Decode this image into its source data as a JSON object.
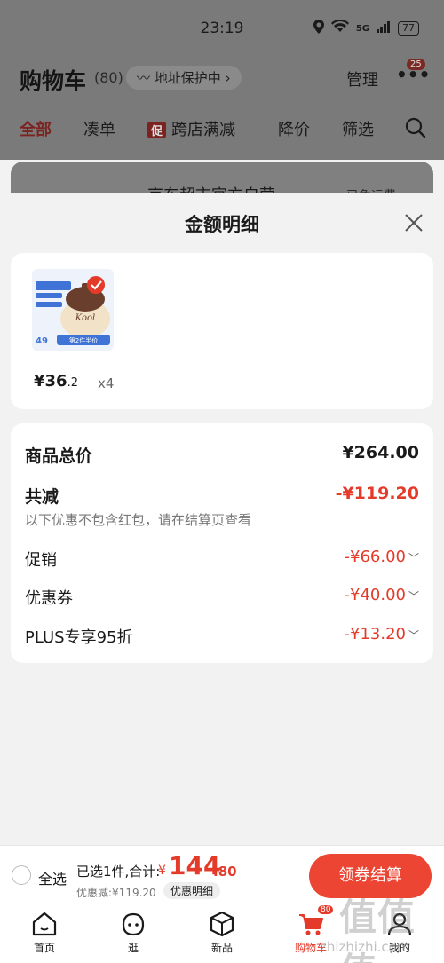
{
  "status": {
    "time": "23:19",
    "signal": "5G",
    "battery": "77"
  },
  "header": {
    "title": "购物车",
    "count": "(80)",
    "address": "地址保护中",
    "manage": "管理",
    "badge": "25"
  },
  "tabs": [
    {
      "label": "全部"
    },
    {
      "label": "凑单"
    },
    {
      "label": "跨店满减",
      "tag": "促"
    },
    {
      "label": "降价"
    },
    {
      "label": "筛选"
    }
  ],
  "background_item": {
    "title": "京东超市官方自营",
    "right": "已免运费"
  },
  "sheet": {
    "title": "金额明细",
    "product": {
      "price_int": "¥36",
      "price_dec": ".2",
      "qty": "x4",
      "image_brand": "Kool",
      "image_promo": "第2件半价",
      "image_price": "49"
    },
    "rows": {
      "total_label": "商品总价",
      "total_value": "¥264.00",
      "reduce_label": "共减",
      "reduce_value": "-¥119.20",
      "note": "以下优惠不包含红包，请在结算页查看",
      "promo_label": "促销",
      "promo_value": "-¥66.00",
      "coupon_label": "优惠券",
      "coupon_value": "-¥40.00",
      "plus_label": "PLUS专享95折",
      "plus_value": "-¥13.20"
    }
  },
  "bottom": {
    "select_all": "全选",
    "selected": "已选1件,合计:",
    "currency": "¥",
    "total_int": "144",
    "total_dec": ".80",
    "discount": "优惠减:¥119.20",
    "detail_chip": "优惠明细",
    "checkout": "领券结算"
  },
  "nav": [
    {
      "label": "首页",
      "icon": "home-icon"
    },
    {
      "label": "逛",
      "icon": "face-icon"
    },
    {
      "label": "新品",
      "icon": "box-icon"
    },
    {
      "label": "购物车",
      "icon": "cart-icon",
      "badge": "80"
    },
    {
      "label": "我的",
      "icon": "user-icon"
    }
  ],
  "watermark": {
    "text": "值值值",
    "url": "zhizhizhi.com"
  },
  "colors": {
    "accent": "#e33a2a",
    "checkout": "#ec4533"
  }
}
